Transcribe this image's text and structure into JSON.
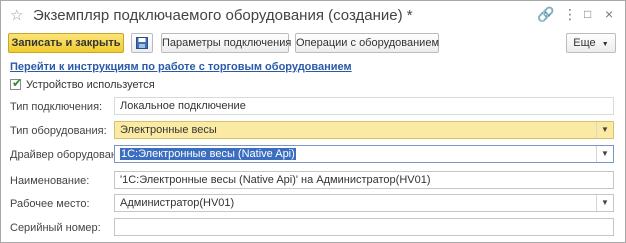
{
  "window": {
    "title": "Экземпляр подключаемого оборудования (создание) *",
    "link_icon": "link-icon",
    "menu_icon": "more-icon",
    "restore_icon": "restore-icon",
    "close_icon": "close-icon"
  },
  "toolbar": {
    "save_close_label": "Записать и закрыть",
    "save_icon": "floppy-disk-icon",
    "connection_params_label": "Параметры подключения",
    "device_operations_label": "Операции с оборудованием",
    "more_label": "Еще"
  },
  "instructions_link": "Перейти к инструкциям по работе с торговым оборудованием",
  "device_used": {
    "label": "Устройство используется",
    "checked": true
  },
  "form": {
    "connection_type": {
      "label": "Тип подключения:",
      "value": "Локальное подключение"
    },
    "equipment_type": {
      "label": "Тип оборудования:",
      "value": "Электронные весы"
    },
    "driver": {
      "label": "Драйвер оборудования:",
      "value": "1С:Электронные весы (Native Api)"
    },
    "name": {
      "label": "Наименование:",
      "value": "'1С:Электронные весы (Native Api)' на Администратор(HV01)"
    },
    "workplace": {
      "label": "Рабочее место:",
      "value": "Администратор(HV01)"
    },
    "serial": {
      "label": "Серийный номер:",
      "value": ""
    }
  },
  "colors": {
    "accent_yellow": "#f1cc2c",
    "link_blue": "#2b59a8",
    "check_green": "#2a8c2a"
  }
}
